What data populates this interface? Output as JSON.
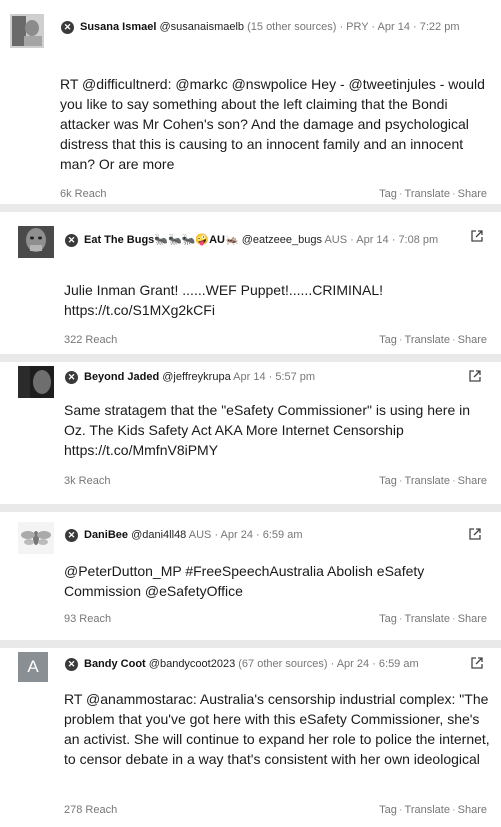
{
  "posts": [
    {
      "name": "Susana Ismael",
      "handle": "@susanaismaelb",
      "sources": "(15 other sources)",
      "meta": "· PRY · Apr 14 · 7:22 pm",
      "body": "RT @difficultnerd: @markc @nswpolice Hey - @tweetinjules - would you like to say something about the left claiming that the Bondi attacker was Mr Cohen's son? And the damage and psychological distress that this is causing to an innocent family and an innocent man? Or are more",
      "reach": "6k Reach"
    },
    {
      "name": "Eat The Bugs🐜🐜🐜🤪AU🦗",
      "handle": "@eatzeee_bugs",
      "sources": "",
      "meta": "AUS · Apr 14 · 7:08 pm",
      "body": "Julie Inman Grant! ......WEF Puppet!......CRIMINAL! https://t.co/S1MXg2kCFi",
      "reach": "322 Reach"
    },
    {
      "name": "Beyond Jaded",
      "handle": "@jeffreykrupa",
      "sources": "",
      "meta": "Apr 14 · 5:57 pm",
      "body": "Same stratagem that the \"eSafety Commissioner\" is using here in Oz. The Kids Safety Act AKA More Internet Censorship https://t.co/MmfnV8iPMY",
      "reach": "3k Reach"
    },
    {
      "name": "DaniBee",
      "handle": "@dani4ll48",
      "sources": "",
      "meta": "AUS · Apr 24 · 6:59 am",
      "body": "@PeterDutton_MP #FreeSpeechAustralia Abolish eSafety Commission @eSafetyOffice",
      "reach": "93 Reach"
    },
    {
      "name": "Bandy Coot",
      "handle": "@bandycoot2023",
      "sources": "(67 other sources)",
      "meta": "· Apr 24 · 6:59 am",
      "body": "RT @anammostarac: Australia's censorship industrial complex: \"The problem that you've got here with this eSafety Commissioner, she's an activist. She will continue to expand her role to police the internet, to censor debate in a way that's consistent with her own ideological",
      "reach": "278 Reach",
      "avatar_letter": "A"
    }
  ],
  "actions": {
    "tag": "Tag",
    "translate": "Translate",
    "share": "Share",
    "sep": "·"
  },
  "icons": {
    "platform": "x-logo-icon",
    "external": "external-link-icon"
  },
  "colors": {
    "separator": "#e9e9e9",
    "muted": "#777777",
    "avatar_letter_bg": "#8a8f94"
  }
}
